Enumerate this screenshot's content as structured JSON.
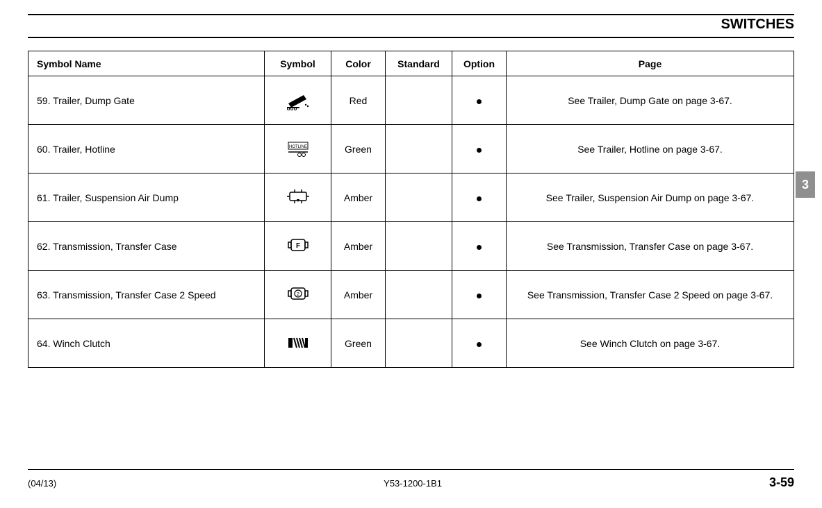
{
  "header": {
    "title": "SWITCHES"
  },
  "side_tab": "3",
  "table": {
    "headers": {
      "name": "Symbol Name",
      "symbol": "Symbol",
      "color": "Color",
      "standard": "Standard",
      "option": "Option",
      "page": "Page"
    },
    "rows": [
      {
        "num": "59.",
        "name": "Trailer, Dump Gate",
        "color": "Red",
        "standard": "",
        "option": true,
        "page": "See Trailer, Dump Gate on page 3-67.",
        "icon": "dump-gate-icon"
      },
      {
        "num": "60.",
        "name": "Trailer, Hotline",
        "color": "Green",
        "standard": "",
        "option": true,
        "page": "See Trailer, Hotline on page 3-67.",
        "icon": "hotline-icon"
      },
      {
        "num": "61.",
        "name": "Trailer, Suspension Air Dump",
        "color": "Amber",
        "standard": "",
        "option": true,
        "page": "See Trailer, Suspension Air Dump on page 3-67.",
        "icon": "air-dump-icon"
      },
      {
        "num": "62.",
        "name": "Transmission, Transfer Case",
        "color": "Amber",
        "standard": "",
        "option": true,
        "page": "See Transmission, Transfer Case on page 3-67.",
        "icon": "transfer-case-icon"
      },
      {
        "num": "63.",
        "name": "Transmission, Transfer Case 2 Speed",
        "color": "Amber",
        "standard": "",
        "option": true,
        "page": "See Transmission, Transfer Case 2 Speed on page 3-67.",
        "icon": "transfer-case-2-icon"
      },
      {
        "num": "64.",
        "name": "Winch Clutch",
        "color": "Green",
        "standard": "",
        "option": true,
        "page": "See Winch Clutch on page 3-67.",
        "icon": "winch-clutch-icon"
      }
    ]
  },
  "footer": {
    "left": "(04/13)",
    "center": "Y53-1200-1B1",
    "right": "3-59"
  }
}
